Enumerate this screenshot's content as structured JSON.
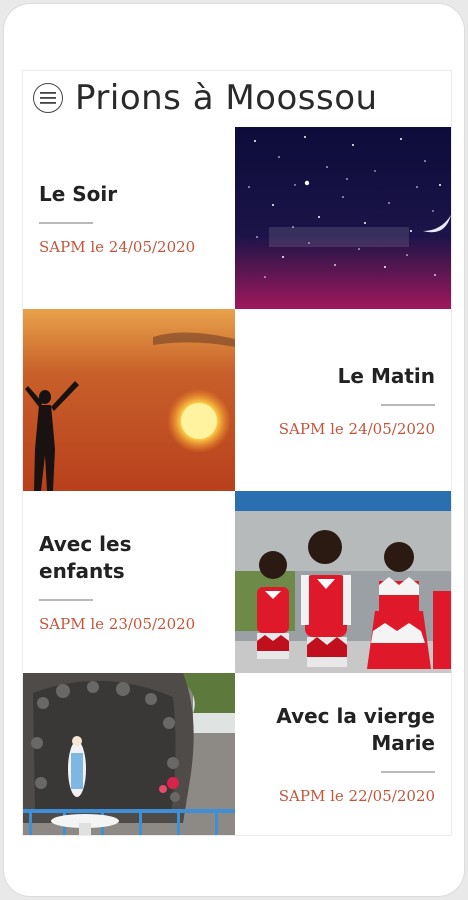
{
  "app": {
    "title": "Prions à Moossou"
  },
  "icons": {
    "menu": "hamburger-menu-icon"
  },
  "posts": [
    {
      "title": "Le Soir",
      "author": "SAPM",
      "date": "24/05/2020",
      "meta": "SAPM le 24/05/2020",
      "image": "night-sky-stars"
    },
    {
      "title": "Le Matin",
      "author": "SAPM",
      "date": "24/05/2020",
      "meta": "SAPM le 24/05/2020",
      "image": "sunrise-silhouette"
    },
    {
      "title": "Avec les enfants",
      "author": "SAPM",
      "date": "23/05/2020",
      "meta": "SAPM le 23/05/2020",
      "image": "children-in-red"
    },
    {
      "title": "Avec la vierge Marie",
      "author": "SAPM",
      "date": "22/05/2020",
      "meta": "SAPM le 22/05/2020",
      "image": "grotto-virgin-mary"
    }
  ],
  "colors": {
    "accent": "#c4553b",
    "title": "#222222",
    "divider": "#b9b9b9"
  }
}
